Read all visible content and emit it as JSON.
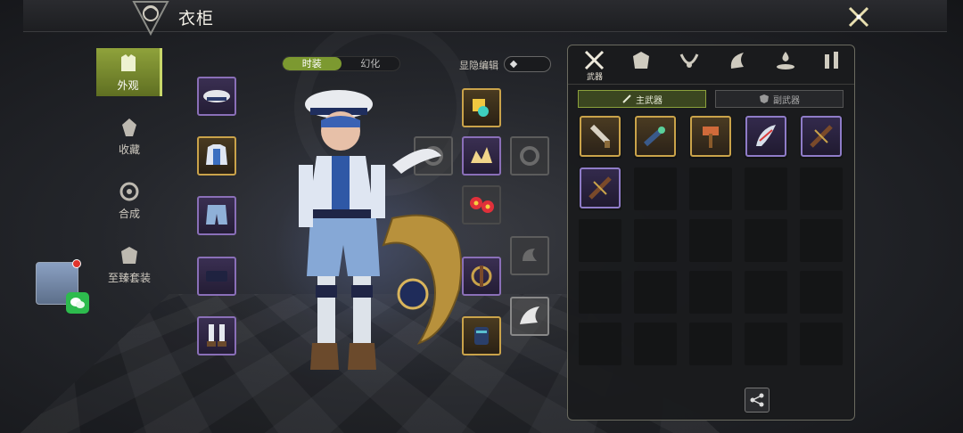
{
  "header": {
    "title": "衣柜"
  },
  "nav": {
    "items": [
      {
        "label": "外观",
        "icon": "armor-icon",
        "active": true
      },
      {
        "label": "收藏",
        "icon": "collection-icon",
        "active": false
      },
      {
        "label": "合成",
        "icon": "synthesis-icon",
        "active": false
      },
      {
        "label": "至臻套装",
        "icon": "supreme-set-icon",
        "active": false
      }
    ]
  },
  "view_tabs": [
    {
      "label": "时装",
      "active": true
    },
    {
      "label": "幻化",
      "active": false
    }
  ],
  "toggle": {
    "label": "显隐编辑"
  },
  "category_tabs": [
    {
      "label": "武器",
      "icon": "crossed-swords-icon",
      "active": true
    },
    {
      "label": "",
      "icon": "helmet-icon"
    },
    {
      "label": "",
      "icon": "necklace-icon"
    },
    {
      "label": "",
      "icon": "wing-icon"
    },
    {
      "label": "",
      "icon": "aura-icon"
    },
    {
      "label": "",
      "icon": "misc-icon"
    }
  ],
  "sub_tabs": [
    {
      "label": "主武器",
      "active": true
    },
    {
      "label": "副武器",
      "active": false
    }
  ],
  "inventory": {
    "items": [
      {
        "icon": "cannon-icon",
        "rarity": "gold"
      },
      {
        "icon": "ornate-gun-icon",
        "rarity": "gold"
      },
      {
        "icon": "hammer-icon",
        "rarity": "gold"
      },
      {
        "icon": "feather-blade-icon",
        "rarity": "purple"
      },
      {
        "icon": "crossbow-icon",
        "rarity": "purple"
      },
      {
        "icon": "crossbow-icon",
        "rarity": "purple"
      }
    ],
    "total_slots": 25
  },
  "colors": {
    "accent": "#7c9930",
    "gold": "#caa34a",
    "purple": "#8f7cc8"
  }
}
